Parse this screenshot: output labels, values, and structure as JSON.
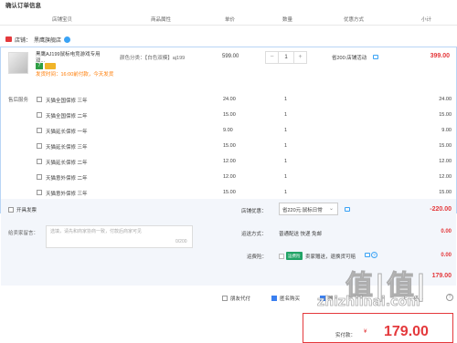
{
  "page": {
    "title": "确认订单信息"
  },
  "columns": [
    "店铺宝贝",
    "商品属性",
    "单价",
    "数量",
    "优惠方式",
    "小计"
  ],
  "shop": {
    "label": "店铺：",
    "name": "黑鹰旗舰店"
  },
  "product": {
    "name": "黑鹰AJ199鼠标电竞游戏专用双...",
    "spec": "颜色分类：【白色双模】aj199",
    "ship_note": "发货时间：16:00前付款，今天发货",
    "unit_price": "599.00",
    "qty": "1",
    "qty_minus": "−",
    "qty_plus": "+",
    "promo": "省200:店铺活动",
    "subtotal": "399.00"
  },
  "service": {
    "title": "售后服务",
    "items": [
      {
        "name": "天猫全国保修 三年",
        "price": "24.00",
        "qty": "1",
        "subtotal": "24.00"
      },
      {
        "name": "天猫全国保修 二年",
        "price": "15.00",
        "qty": "1",
        "subtotal": "15.00"
      },
      {
        "name": "天猫延长保修 一年",
        "price": "9.00",
        "qty": "1",
        "subtotal": "9.00"
      },
      {
        "name": "天猫延长保修 三年",
        "price": "15.00",
        "qty": "1",
        "subtotal": "15.00"
      },
      {
        "name": "天猫延长保修 二年",
        "price": "12.00",
        "qty": "1",
        "subtotal": "12.00"
      },
      {
        "name": "天猫意外保修 二年",
        "price": "12.00",
        "qty": "1",
        "subtotal": "12.00"
      },
      {
        "name": "天猫意外保修 三年",
        "price": "15.00",
        "qty": "1",
        "subtotal": "15.00"
      }
    ]
  },
  "invoice": {
    "label": "开具发票"
  },
  "message": {
    "label": "给卖家留言：",
    "placeholder": "选填，请先和商家协商一致，付款后商家可见",
    "count": "0/200"
  },
  "coupon": {
    "label": "店铺优惠：",
    "selected": "省220元:鼠标日常",
    "value": "-220.00"
  },
  "shipping": {
    "label": "运送方式：",
    "text": "普通配送 快递 免邮",
    "value": "0.00"
  },
  "insurance": {
    "label": "运费险：",
    "badge": "运费险",
    "text": "卖家赠送，退换货可赔",
    "value": "0.00"
  },
  "total_line": "179.00",
  "options": [
    {
      "label": "朋友代付",
      "checked": false
    },
    {
      "label": "匿名购买",
      "checked": true
    },
    {
      "label": "赠",
      "checked": false
    }
  ],
  "options_more": "上··· 借 ··",
  "pay": {
    "label": "实付款：",
    "currency": "¥",
    "amount": "179.00"
  },
  "watermark": {
    "big": "值|值|",
    "small": "zhizhiinai.com"
  },
  "colors": {
    "accent": "#e4393c",
    "border": "#b9d5f5",
    "link": "#3aa3f5",
    "panel": "#f3f6fb"
  }
}
